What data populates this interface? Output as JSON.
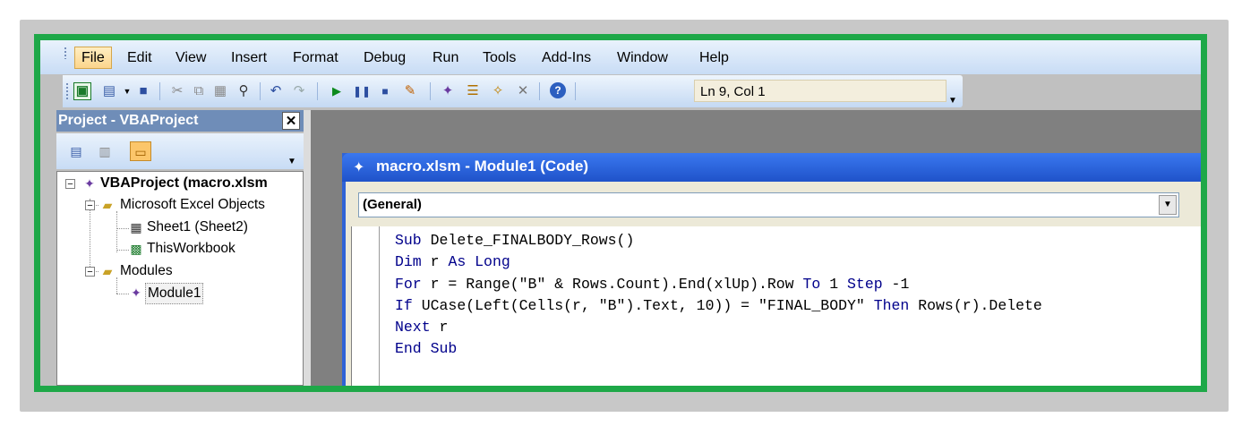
{
  "menu": {
    "items": [
      {
        "label": "File",
        "active": true
      },
      {
        "label": "Edit"
      },
      {
        "label": "View"
      },
      {
        "label": "Insert"
      },
      {
        "label": "Format"
      },
      {
        "label": "Debug"
      },
      {
        "label": "Run"
      },
      {
        "label": "Tools"
      },
      {
        "label": "Add-Ins"
      },
      {
        "label": "Window"
      },
      {
        "label": "Help"
      }
    ]
  },
  "toolbar": {
    "status": "Ln 9, Col 1",
    "icons": [
      "view-excel-icon",
      "insert-userform-icon",
      "save-icon",
      "cut-icon",
      "copy-icon",
      "paste-icon",
      "find-icon",
      "undo-icon",
      "redo-icon",
      "run-icon",
      "break-icon",
      "reset-icon",
      "design-mode-icon",
      "project-explorer-icon",
      "properties-icon",
      "object-browser-icon",
      "toolbox-icon",
      "help-icon"
    ]
  },
  "project": {
    "title": "Project - VBAProject",
    "tree": {
      "root": "VBAProject (macro.xlsm",
      "excel_objects": "Microsoft Excel Objects",
      "sheet1": "Sheet1 (Sheet2)",
      "thisworkbook": "ThisWorkbook",
      "modules": "Modules",
      "module1": "Module1"
    }
  },
  "code_window": {
    "title": "macro.xlsm - Module1 (Code)",
    "object_dropdown": "(General)",
    "lines": [
      {
        "kw": "Sub",
        "rest": " Delete_FINALBODY_Rows()"
      },
      {
        "kw": "Dim",
        "rest": " r ",
        "kw2": "As Long",
        "rest2": ""
      },
      {
        "kw": "For",
        "rest": " r = Range(\"B\" & Rows.Count).End(xlUp).Row ",
        "kw2": "To",
        "rest2": " 1 ",
        "kw3": "Step",
        "rest3": " -1"
      },
      {
        "kw": "If",
        "rest": " UCase(Left(Cells(r, \"B\").Text, 10)) = \"FINAL_BODY\" ",
        "kw2": "Then",
        "rest2": " Rows(r).Delete"
      },
      {
        "kw": "Next",
        "rest": " r"
      },
      {
        "kw": "End Sub",
        "rest": ""
      }
    ]
  }
}
